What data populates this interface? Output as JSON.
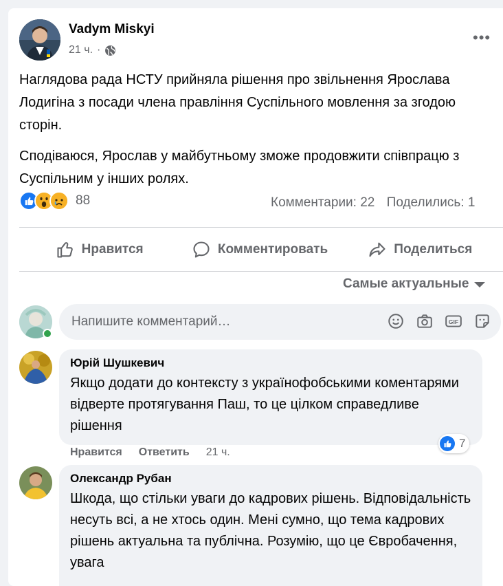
{
  "post": {
    "author": "Vadym Miskyi",
    "time": "21 ч.",
    "separator": "·",
    "more_label": "•••",
    "paragraphs": [
      "Наглядова рада НСТУ прийняла рішення про звільнення Ярослава Лодигіна з посади члена правління Суспільного мовлення за згодою сторін.",
      "Сподіваюся, Ярослав у майбутньому зможе продовжити співпрацю з Суспільним у інших ролях."
    ],
    "reactions": {
      "icons": [
        "like",
        "wow",
        "sad"
      ],
      "count": "88"
    },
    "comments_count": "Комментарии: 22",
    "shares_count": "Поделились: 1"
  },
  "actions": {
    "like": "Нравится",
    "comment": "Комментировать",
    "share": "Поделиться"
  },
  "sort": {
    "label": "Самые актуальные"
  },
  "composer": {
    "placeholder": "Напишите комментарий…",
    "icons": [
      "emoji-icon",
      "camera-icon",
      "gif-icon",
      "sticker-icon"
    ]
  },
  "comments": [
    {
      "author": "Юрій Шушкевич",
      "text": "Якщо додати до контексту з українофобськими коментарями відверте протягування Паш, то це цілком справедливе рішення",
      "like_label": "Нравится",
      "reply_label": "Ответить",
      "time": "21 ч.",
      "reaction_count": "7"
    },
    {
      "author": "Олександр Рубан",
      "text": "Шкода, що стільки уваги до кадрових рішень. Відповідальність несуть всі, а не хтось один. Мені сумно, що тема кадрових рішень актуальна та публічна. Розумію, що це Євробачення, увага"
    }
  ],
  "colors": {
    "accent": "#1877f2",
    "secondary_text": "#65676b",
    "bubble": "#f0f2f5",
    "online": "#31a24c"
  }
}
